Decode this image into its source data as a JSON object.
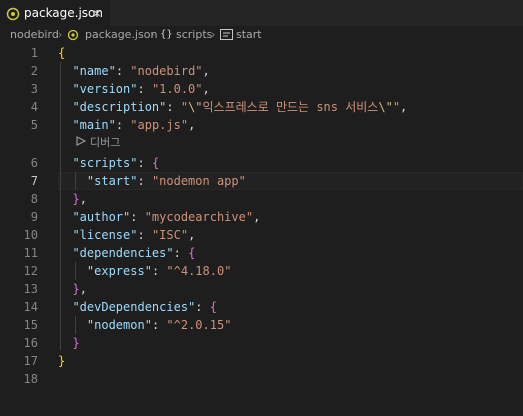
{
  "tab": {
    "filename": "package.json",
    "close_glyph": "×"
  },
  "breadcrumb": {
    "folder": "nodebird",
    "file": "package.json",
    "scripts": "scripts",
    "start": "start",
    "scripts_icon": "{}"
  },
  "codelens": {
    "debug_label": "디버그"
  },
  "lines": {
    "n1": "1",
    "n2": "2",
    "n3": "3",
    "n4": "4",
    "n5": "5",
    "n6": "6",
    "n7": "7",
    "n8": "8",
    "n9": "9",
    "n10": "10",
    "n11": "11",
    "n12": "12",
    "n13": "13",
    "n14": "14",
    "n15": "15",
    "n16": "16",
    "n17": "17",
    "n18": "18"
  },
  "json": {
    "open_brace": "{",
    "close_brace": "}",
    "name_key": "\"name\"",
    "name_val": "\"nodebird\"",
    "version_key": "\"version\"",
    "version_val": "\"1.0.0\"",
    "desc_key": "\"description\"",
    "desc_q1": "\"",
    "desc_esc1": "\\\"",
    "desc_text": "익스프레스로 만드는 sns 서비스",
    "desc_esc2": "\\\"",
    "desc_q2": "\"",
    "main_key": "\"main\"",
    "main_val": "\"app.js\"",
    "scripts_key": "\"scripts\"",
    "start_key": "\"start\"",
    "start_val": "\"nodemon app\"",
    "author_key": "\"author\"",
    "author_val": "\"mycodearchive\"",
    "license_key": "\"license\"",
    "license_val": "\"ISC\"",
    "deps_key": "\"dependencies\"",
    "express_key": "\"express\"",
    "express_val": "\"^4.18.0\"",
    "devdeps_key": "\"devDependencies\"",
    "nodemon_key": "\"nodemon\"",
    "nodemon_val": "\"^2.0.15\""
  },
  "colors": {
    "background": "#1e1e1e",
    "key": "#9cdcfe",
    "string": "#ce9178",
    "bracket1": "#ffd700",
    "bracket2": "#da70d6",
    "json_icon": "#cbcb41"
  },
  "active_line": 7
}
